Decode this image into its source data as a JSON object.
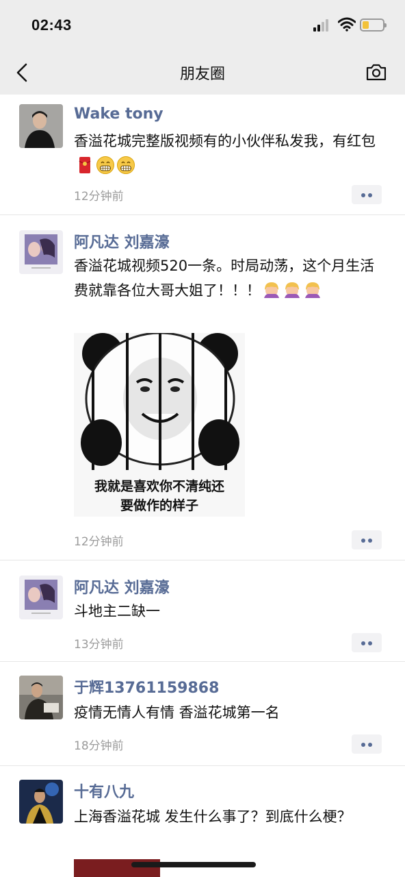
{
  "status_bar": {
    "time": "02:43"
  },
  "nav": {
    "title": "朋友圈",
    "back_icon": "chevron-left-icon",
    "camera_icon": "camera-icon"
  },
  "posts": [
    {
      "author": "Wake tony",
      "text": "香溢花城完整版视频有的小伙伴私发我，有红包",
      "emojis": [
        "red-envelope",
        "grin",
        "grin"
      ],
      "time": "12分钟前"
    },
    {
      "author": "阿凡达 刘嘉濠",
      "text": "香溢花城视频520一条。时局动荡，这个月生活费就靠各位大哥大姐了！！！",
      "emojis": [
        "woman-bowing",
        "woman-bowing",
        "woman-bowing"
      ],
      "image_caption_line1": "我就是喜欢你不清纯还",
      "image_caption_line2": "要做作的样子",
      "time": "12分钟前"
    },
    {
      "author": "阿凡达 刘嘉濠",
      "text": "斗地主二缺一",
      "time": "13分钟前"
    },
    {
      "author": "于辉13761159868",
      "text": "疫情无情人有情 香溢花城第一名",
      "time": "18分钟前"
    },
    {
      "author": "十有八九",
      "text": "上海香溢花城 发生什么事了？到底什么梗？"
    }
  ],
  "colors": {
    "link": "#576b95",
    "time": "#9b9b9b",
    "nav_bg": "#ededed"
  }
}
